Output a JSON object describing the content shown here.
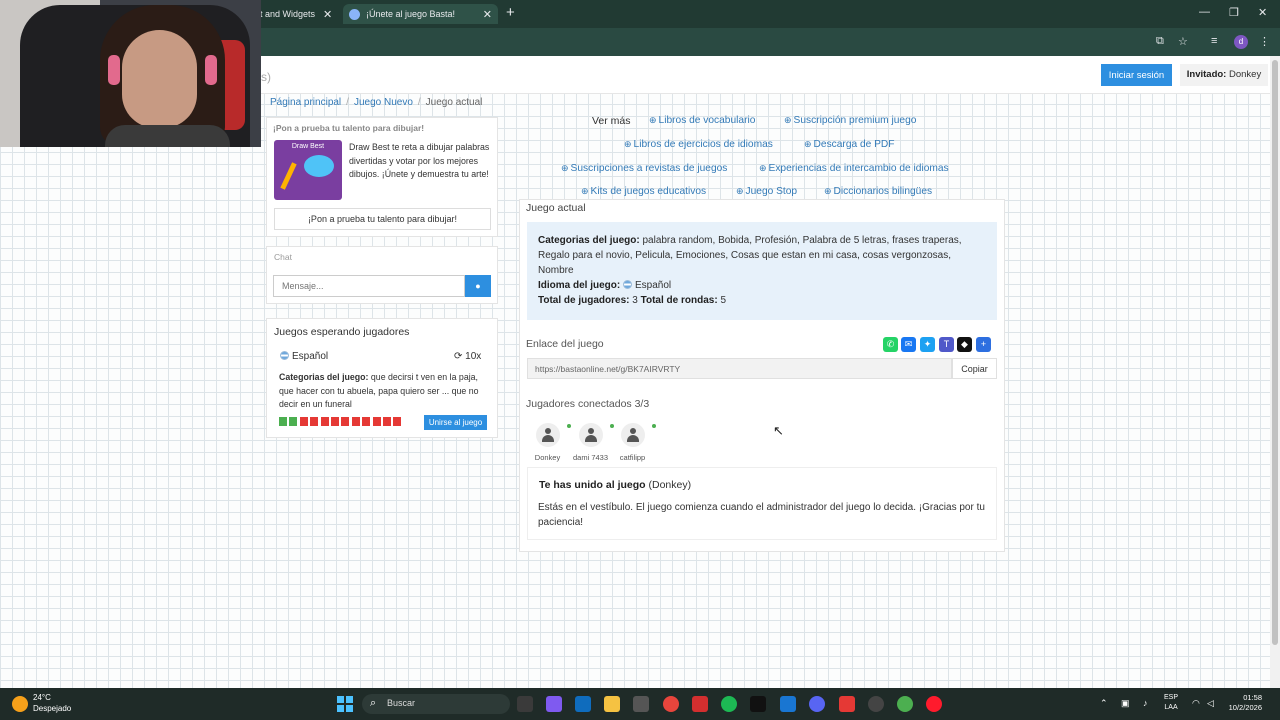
{
  "browser": {
    "tabs": [
      {
        "label": "ot and Widgets"
      },
      {
        "label": "¡Únete al juego Basta!"
      }
    ]
  },
  "header": {
    "logo_fragment": "s)",
    "login_label": "Iniciar sesión",
    "guest_label": "Invitado:",
    "guest_name": "Donkey"
  },
  "breadcrumb": {
    "home": "Página principal",
    "new_game": "Juego Nuevo",
    "current": "Juego actual"
  },
  "draw_promo": {
    "title": "¡Pon a prueba tu talento para dibujar!",
    "image_text": "Draw Best",
    "text": "Draw Best te reta a dibujar palabras divertidas y votar por los mejores dibujos. ¡Únete y demuestra tu arte!",
    "button": "¡Pon a prueba tu talento para dibujar!"
  },
  "chat": {
    "title": "Chat",
    "placeholder": "Mensaje..."
  },
  "waiting": {
    "title": "Juegos esperando jugadores",
    "language": "Español",
    "rounds": "10x",
    "categories_label": "Categorias del juego:",
    "categories": "que decirsi t ven en la paja, que hacer con tu abuela, papa quiero ser ... que no decir en un funeral",
    "players_filled": 2,
    "players_total": 12,
    "join_label": "Unirse al juego"
  },
  "links": {
    "more": "Ver más",
    "items": [
      "Libros de vocabulario",
      "Suscripción premium juego",
      "Libros de ejercicios de idiomas",
      "Descarga de PDF",
      "Suscripciones a revistas de juegos",
      "Experiencias de intercambio de idiomas",
      "Kits de juegos educativos",
      "Juego Stop",
      "Diccionarios bilingües"
    ]
  },
  "game": {
    "title": "Juego actual",
    "categories_label": "Categorias del juego:",
    "categories": "palabra random, Bobida, Profesión, Palabra de 5 letras, frases traperas, Regalo para el novio, Pelicula, Emociones, Cosas que estan en mi casa, cosas vergonzosas, Nombre",
    "language_label": "Idioma del juego:",
    "language": "Español",
    "players_label": "Total de jugadores:",
    "players": "3",
    "rounds_label": "Total de rondas:",
    "rounds": "5",
    "link_label": "Enlace del juego",
    "link": "https://bastaonline.net/g/BK7AIRVRTY",
    "copy_label": "Copiar",
    "connected_label": "Jugadores conectados 3/3",
    "players_list": [
      "Donkey",
      "dami 7433",
      "catfilipp"
    ],
    "joined_title": "Te has unido al juego",
    "joined_name": "(Donkey)",
    "joined_text": "Estás en el vestíbulo. El juego comienza cuando el administrador del juego lo decida. ¡Gracias por tu paciencia!"
  },
  "taskbar": {
    "temp": "24°C",
    "condition": "Despejado",
    "search": "Buscar",
    "lang1": "ESP",
    "lang2": "LAA",
    "time": "01:58",
    "date": "10/2/2026"
  },
  "colors": {
    "accent": "#2d8fe0",
    "link": "#337ab7",
    "info_bg": "#e7f1fa"
  }
}
